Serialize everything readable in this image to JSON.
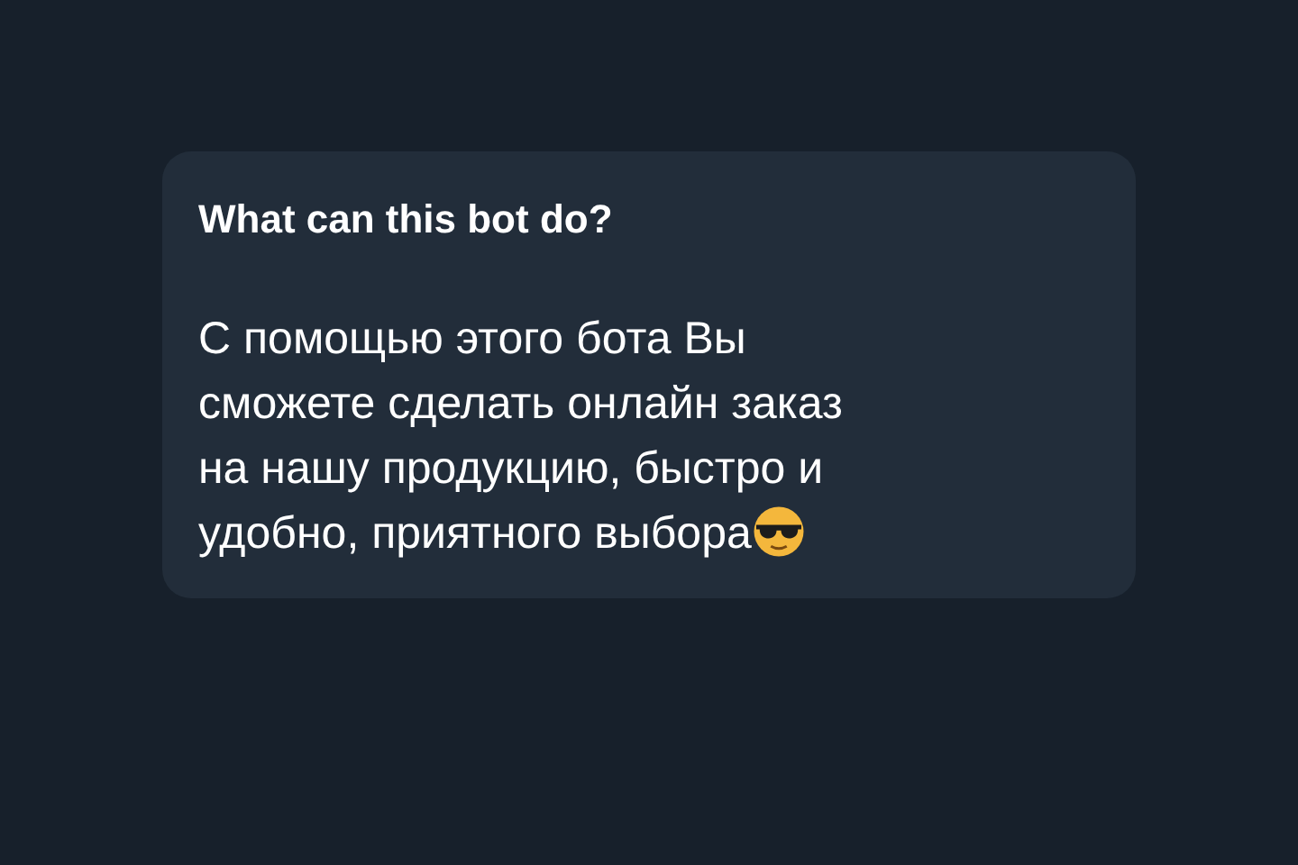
{
  "card": {
    "title": "What can this bot do?",
    "lines": [
      "С помощью этого бота Вы",
      "сможете сделать онлайн заказ",
      "на нашу продукцию, быстро и",
      "удобно, приятного выбора"
    ]
  }
}
